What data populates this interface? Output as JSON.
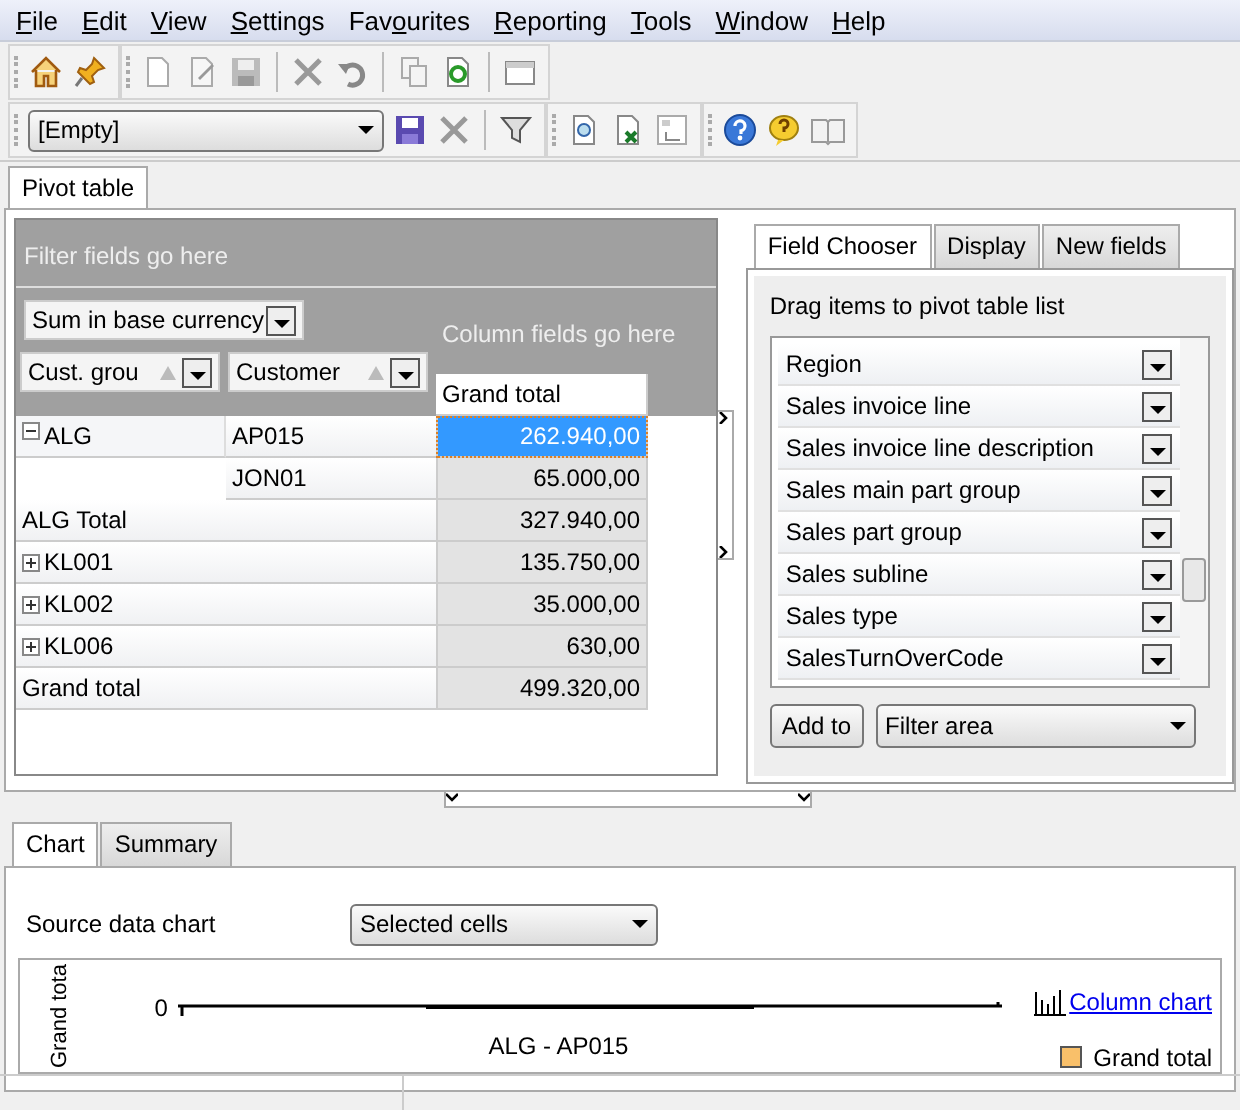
{
  "menu": [
    {
      "key": "F",
      "post": "ile"
    },
    {
      "key": "E",
      "post": "dit"
    },
    {
      "key": "V",
      "post": "iew"
    },
    {
      "key": "S",
      "post": "ettings"
    },
    {
      "pre": "Fav",
      "key": "o",
      "post": "urites"
    },
    {
      "key": "R",
      "post": "eporting"
    },
    {
      "key": "T",
      "post": "ools"
    },
    {
      "key": "W",
      "post": "indow"
    },
    {
      "key": "H",
      "post": "elp"
    }
  ],
  "layout_select": {
    "value": "[Empty]"
  },
  "main_tabs": [
    {
      "label": "Pivot table",
      "selected": true
    }
  ],
  "pivot": {
    "filter_placeholder": "Filter fields go here",
    "data_field": "Sum in base currency",
    "column_placeholder": "Column fields go here",
    "row_fields": [
      "Cust. grou",
      "Customer"
    ],
    "column_header": "Grand total",
    "rows": [
      {
        "kind": "group",
        "label": "ALG",
        "expanded": true,
        "children": [
          {
            "label": "AP015",
            "value": "262.940,00",
            "selected": true
          },
          {
            "label": "JON01",
            "value": "65.000,00",
            "selected": false
          }
        ]
      },
      {
        "kind": "total",
        "label": "ALG Total",
        "value": "327.940,00",
        "selected": false
      },
      {
        "kind": "group",
        "label": "KL001",
        "expanded": false,
        "value": "135.750,00",
        "selected": false
      },
      {
        "kind": "group",
        "label": "KL002",
        "expanded": false,
        "value": "35.000,00",
        "selected": false
      },
      {
        "kind": "group",
        "label": "KL006",
        "expanded": false,
        "value": "630,00",
        "selected": false
      },
      {
        "kind": "total",
        "label": "Grand total",
        "value": "499.320,00",
        "selected": false
      }
    ]
  },
  "side_tabs": [
    {
      "label": "Field Chooser",
      "selected": true
    },
    {
      "label": "Display",
      "selected": false
    },
    {
      "label": "New fields",
      "selected": false
    }
  ],
  "field_chooser": {
    "instruction": "Drag items to pivot table list",
    "fields": [
      "Region",
      "Sales invoice line",
      "Sales invoice line description",
      "Sales main part group",
      "Sales part group",
      "Sales subline",
      "Sales type",
      "SalesTurnOverCode"
    ],
    "add_button": "Add to",
    "target": "Filter area"
  },
  "bottom_tabs": [
    {
      "label": "Chart",
      "selected": true
    },
    {
      "label": "Summary",
      "selected": false
    }
  ],
  "chart_panel": {
    "source_label": "Source data chart",
    "source_value": "Selected cells",
    "ylabel": "Grand tota",
    "tick": "0",
    "category": "ALG - AP015",
    "link": "Column chart",
    "legend": "Grand total"
  }
}
